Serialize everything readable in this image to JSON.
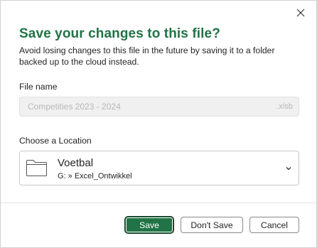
{
  "dialog": {
    "title": "Save your changes to this file?",
    "subtitle": "Avoid losing changes to this file in the future by saving it to a folder backed up to the cloud instead."
  },
  "filename": {
    "label": "File name",
    "value": "Competities 2023 - 2024",
    "extension": ".xlsb"
  },
  "location": {
    "label": "Choose a Location",
    "folder_name": "Voetbal",
    "folder_path": "G: » Excel_Ontwikkel",
    "icon": "folder-icon"
  },
  "buttons": {
    "save_label": "Save",
    "save_mnemonic": "S",
    "save_rest": "ave",
    "dont_save_label": "Don't Save",
    "dont_save_pre": "Do",
    "dont_save_mnemonic": "n",
    "dont_save_rest": "'t Save",
    "cancel_label": "Cancel"
  },
  "colors": {
    "accent": "#217346",
    "text": "#242424",
    "disabled_text": "#b8b8b8"
  }
}
